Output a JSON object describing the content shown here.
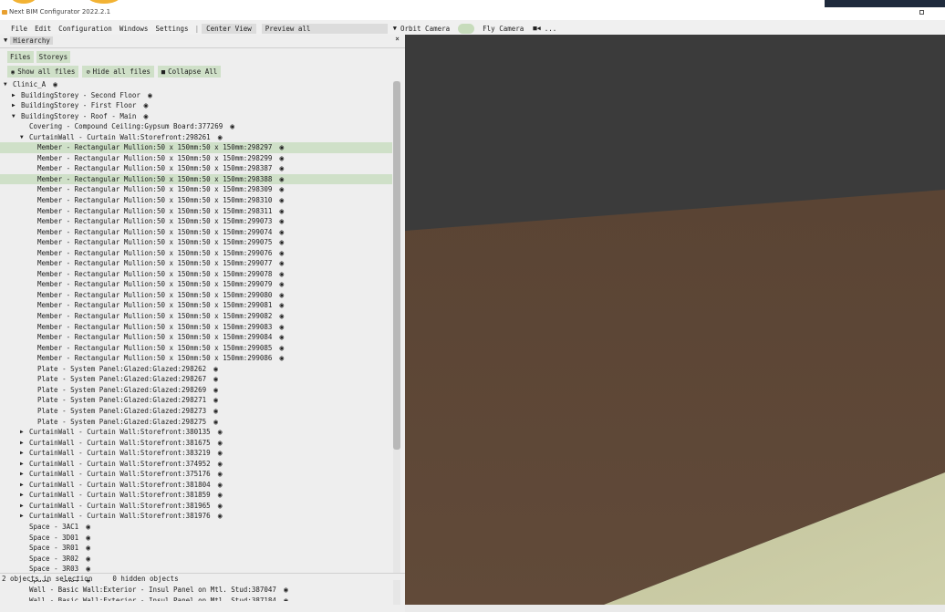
{
  "window": {
    "title": "Next BIM Configurator 2022.2.1"
  },
  "menu": {
    "items": [
      "File",
      "Edit",
      "Configuration",
      "Windows",
      "Settings"
    ],
    "separator": "|",
    "center_view": "Center View",
    "preview": "Preview all",
    "orbit_camera": "Orbit Camera",
    "fly_camera": "Fly Camera",
    "ellipsis": "..."
  },
  "hierarchy": {
    "title": "Hierarchy",
    "close": "×",
    "tabs": [
      "Files",
      "Storeys"
    ],
    "actions": {
      "show_all": "Show all files",
      "hide_all": "Hide all files",
      "collapse_all": "Collapse All"
    },
    "tree": [
      {
        "level": 0,
        "caret": "down",
        "label": "Clinic_A"
      },
      {
        "level": 1,
        "caret": "right",
        "label": "BuildingStorey - Second Floor"
      },
      {
        "level": 1,
        "caret": "right",
        "label": "BuildingStorey - First Floor"
      },
      {
        "level": 1,
        "caret": "down",
        "label": "BuildingStorey - Roof - Main"
      },
      {
        "level": 2,
        "caret": "none",
        "label": "Covering - Compound Ceiling:Gypsum Board:377269"
      },
      {
        "level": 2,
        "caret": "down",
        "label": "CurtainWall - Curtain Wall:Storefront:298261"
      },
      {
        "level": 3,
        "caret": "none",
        "label": "Member - Rectangular Mullion:50 x 150mm:50 x 150mm:298297",
        "selected": true
      },
      {
        "level": 3,
        "caret": "none",
        "label": "Member - Rectangular Mullion:50 x 150mm:50 x 150mm:298299"
      },
      {
        "level": 3,
        "caret": "none",
        "label": "Member - Rectangular Mullion:50 x 150mm:50 x 150mm:298387"
      },
      {
        "level": 3,
        "caret": "none",
        "label": "Member - Rectangular Mullion:50 x 150mm:50 x 150mm:298388",
        "selected": true
      },
      {
        "level": 3,
        "caret": "none",
        "label": "Member - Rectangular Mullion:50 x 150mm:50 x 150mm:298309"
      },
      {
        "level": 3,
        "caret": "none",
        "label": "Member - Rectangular Mullion:50 x 150mm:50 x 150mm:298310"
      },
      {
        "level": 3,
        "caret": "none",
        "label": "Member - Rectangular Mullion:50 x 150mm:50 x 150mm:298311"
      },
      {
        "level": 3,
        "caret": "none",
        "label": "Member - Rectangular Mullion:50 x 150mm:50 x 150mm:299073"
      },
      {
        "level": 3,
        "caret": "none",
        "label": "Member - Rectangular Mullion:50 x 150mm:50 x 150mm:299074"
      },
      {
        "level": 3,
        "caret": "none",
        "label": "Member - Rectangular Mullion:50 x 150mm:50 x 150mm:299075"
      },
      {
        "level": 3,
        "caret": "none",
        "label": "Member - Rectangular Mullion:50 x 150mm:50 x 150mm:299076"
      },
      {
        "level": 3,
        "caret": "none",
        "label": "Member - Rectangular Mullion:50 x 150mm:50 x 150mm:299077"
      },
      {
        "level": 3,
        "caret": "none",
        "label": "Member - Rectangular Mullion:50 x 150mm:50 x 150mm:299078"
      },
      {
        "level": 3,
        "caret": "none",
        "label": "Member - Rectangular Mullion:50 x 150mm:50 x 150mm:299079"
      },
      {
        "level": 3,
        "caret": "none",
        "label": "Member - Rectangular Mullion:50 x 150mm:50 x 150mm:299080"
      },
      {
        "level": 3,
        "caret": "none",
        "label": "Member - Rectangular Mullion:50 x 150mm:50 x 150mm:299081"
      },
      {
        "level": 3,
        "caret": "none",
        "label": "Member - Rectangular Mullion:50 x 150mm:50 x 150mm:299082"
      },
      {
        "level": 3,
        "caret": "none",
        "label": "Member - Rectangular Mullion:50 x 150mm:50 x 150mm:299083"
      },
      {
        "level": 3,
        "caret": "none",
        "label": "Member - Rectangular Mullion:50 x 150mm:50 x 150mm:299084"
      },
      {
        "level": 3,
        "caret": "none",
        "label": "Member - Rectangular Mullion:50 x 150mm:50 x 150mm:299085"
      },
      {
        "level": 3,
        "caret": "none",
        "label": "Member - Rectangular Mullion:50 x 150mm:50 x 150mm:299086"
      },
      {
        "level": 3,
        "caret": "none",
        "label": "Plate - System Panel:Glazed:Glazed:298262"
      },
      {
        "level": 3,
        "caret": "none",
        "label": "Plate - System Panel:Glazed:Glazed:298267"
      },
      {
        "level": 3,
        "caret": "none",
        "label": "Plate - System Panel:Glazed:Glazed:298269"
      },
      {
        "level": 3,
        "caret": "none",
        "label": "Plate - System Panel:Glazed:Glazed:298271"
      },
      {
        "level": 3,
        "caret": "none",
        "label": "Plate - System Panel:Glazed:Glazed:298273"
      },
      {
        "level": 3,
        "caret": "none",
        "label": "Plate - System Panel:Glazed:Glazed:298275"
      },
      {
        "level": 2,
        "caret": "right",
        "label": "CurtainWall - Curtain Wall:Storefront:380135"
      },
      {
        "level": 2,
        "caret": "right",
        "label": "CurtainWall - Curtain Wall:Storefront:381675"
      },
      {
        "level": 2,
        "caret": "right",
        "label": "CurtainWall - Curtain Wall:Storefront:383219"
      },
      {
        "level": 2,
        "caret": "right",
        "label": "CurtainWall - Curtain Wall:Storefront:374952"
      },
      {
        "level": 2,
        "caret": "right",
        "label": "CurtainWall - Curtain Wall:Storefront:375176"
      },
      {
        "level": 2,
        "caret": "right",
        "label": "CurtainWall - Curtain Wall:Storefront:381804"
      },
      {
        "level": 2,
        "caret": "right",
        "label": "CurtainWall - Curtain Wall:Storefront:381859"
      },
      {
        "level": 2,
        "caret": "right",
        "label": "CurtainWall - Curtain Wall:Storefront:381965"
      },
      {
        "level": 2,
        "caret": "right",
        "label": "CurtainWall - Curtain Wall:Storefront:381976"
      },
      {
        "level": 2,
        "caret": "none",
        "label": "Space - 3AC1"
      },
      {
        "level": 2,
        "caret": "none",
        "label": "Space - 3D01"
      },
      {
        "level": 2,
        "caret": "none",
        "label": "Space - 3R01"
      },
      {
        "level": 2,
        "caret": "none",
        "label": "Space - 3R02"
      },
      {
        "level": 2,
        "caret": "none",
        "label": "Space - 3R03"
      },
      {
        "level": 2,
        "caret": "none",
        "label": "Space - 3R04"
      },
      {
        "level": 2,
        "caret": "none",
        "label": "Wall - Basic Wall:Exterior - Insul Panel on Mtl. Stud:387047"
      },
      {
        "level": 2,
        "caret": "none",
        "label": "Wall - Basic Wall:Exterior - Insul Panel on Mtl. Stud:387184"
      }
    ]
  },
  "status": {
    "selection": "2 objects in selection",
    "hidden": "0 hidden objects"
  },
  "colors": {
    "accent": "#f2b233",
    "selection": "#cfe0c8",
    "wall": "#5e4737",
    "floor": "#c9c9a2",
    "ceiling": "#3b3b3b"
  },
  "icons": {
    "eye": "eye-icon",
    "eye_slash": "eye-slash-icon",
    "folder": "folder-icon",
    "camera": "video-camera-icon"
  }
}
